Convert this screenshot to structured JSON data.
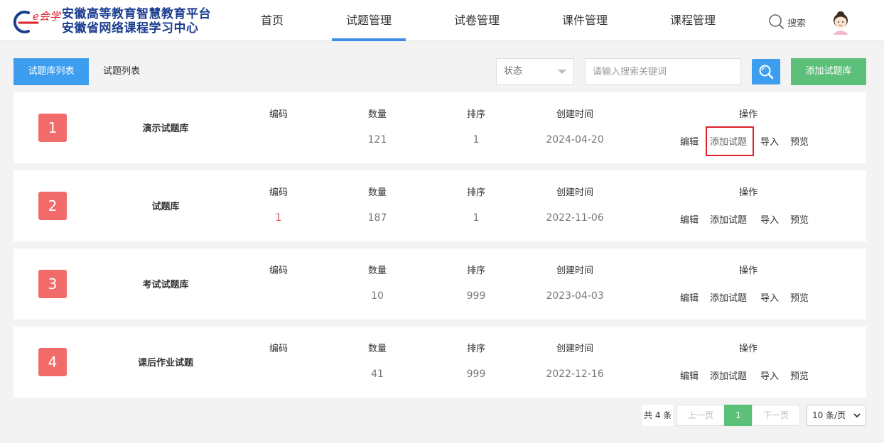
{
  "header": {
    "logo_line1": "安徽高等教育智慧教育平台",
    "logo_line2": "安徽省网络课程学习中心",
    "logo_mark_text": "e会学",
    "nav": [
      {
        "label": "首页"
      },
      {
        "label": "试题管理",
        "active": true
      },
      {
        "label": "试卷管理"
      },
      {
        "label": "课件管理"
      },
      {
        "label": "课程管理"
      }
    ],
    "search_label": "搜索"
  },
  "toolbar": {
    "tab_bank_list": "试题库列表",
    "tab_question_list": "试题列表",
    "status_placeholder": "状态",
    "search_placeholder": "请输入搜索关键词",
    "add_bank_label": "添加试题库"
  },
  "columns": {
    "code": "编码",
    "count": "数量",
    "sort": "排序",
    "created": "创建时间",
    "ops": "操作"
  },
  "ops": {
    "edit": "编辑",
    "add_question": "添加试题",
    "import": "导入",
    "preview": "预览"
  },
  "banks": [
    {
      "index": "1",
      "name": "演示试题库",
      "code": "",
      "count": "121",
      "sort": "1",
      "created": "2024-04-20"
    },
    {
      "index": "2",
      "name": "试题库",
      "code": "1",
      "count": "187",
      "sort": "1",
      "created": "2022-11-06"
    },
    {
      "index": "3",
      "name": "考试试题库",
      "code": "",
      "count": "10",
      "sort": "999",
      "created": "2023-04-03"
    },
    {
      "index": "4",
      "name": "课后作业试题",
      "code": "",
      "count": "41",
      "sort": "999",
      "created": "2022-12-16"
    }
  ],
  "pagination": {
    "total": "共 4 条",
    "prev": "上一页",
    "current": "1",
    "next": "下一页",
    "page_size": "10 条/页"
  },
  "colors": {
    "primary_blue": "#3d9ef0",
    "green": "#5cbf7a",
    "index_red": "#f26b6b",
    "highlight_red": "#e0202a"
  }
}
